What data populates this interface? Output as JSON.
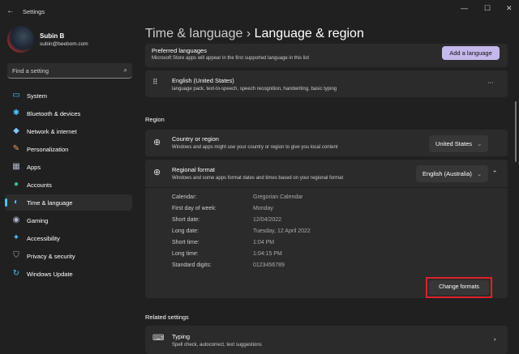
{
  "window": {
    "title": "Settings"
  },
  "user": {
    "name": "Subin B",
    "email": "subin@beebom.com"
  },
  "search": {
    "placeholder": "Find a setting"
  },
  "nav": [
    {
      "label": "System",
      "icon": "monitor-icon"
    },
    {
      "label": "Bluetooth & devices",
      "icon": "bluetooth-icon"
    },
    {
      "label": "Network & internet",
      "icon": "wifi-icon"
    },
    {
      "label": "Personalization",
      "icon": "brush-icon"
    },
    {
      "label": "Apps",
      "icon": "apps-icon"
    },
    {
      "label": "Accounts",
      "icon": "person-icon"
    },
    {
      "label": "Time & language",
      "icon": "globe-clock-icon",
      "selected": true
    },
    {
      "label": "Gaming",
      "icon": "gamepad-icon"
    },
    {
      "label": "Accessibility",
      "icon": "accessibility-icon"
    },
    {
      "label": "Privacy & security",
      "icon": "shield-icon"
    },
    {
      "label": "Windows Update",
      "icon": "update-icon"
    }
  ],
  "header": {
    "parent": "Time & language",
    "sep": "›",
    "current": "Language & region"
  },
  "preferred": {
    "title": "Preferred languages",
    "desc": "Microsoft Store apps will appear in the first supported language in this list",
    "button": "Add a language"
  },
  "language": {
    "name": "English (United States)",
    "desc": "language pack, text-to-speech, speech recognition, handwriting, basic typing",
    "more": "···"
  },
  "region": {
    "section": "Region",
    "country": {
      "title": "Country or region",
      "desc": "Windows and apps might use your country or region to give you local content",
      "value": "United States"
    },
    "format": {
      "title": "Regional format",
      "desc": "Windows and some apps format dates and times based on your regional format",
      "value": "English (Australia)",
      "details": [
        {
          "label": "Calendar:",
          "value": "Gregorian Calendar"
        },
        {
          "label": "First day of week:",
          "value": "Monday"
        },
        {
          "label": "Short date:",
          "value": "12/04/2022"
        },
        {
          "label": "Long date:",
          "value": "Tuesday, 12 April 2022"
        },
        {
          "label": "Short time:",
          "value": "1:04 PM"
        },
        {
          "label": "Long time:",
          "value": "1:04:15 PM"
        },
        {
          "label": "Standard digits:",
          "value": "0123456789"
        }
      ],
      "button": "Change formats"
    }
  },
  "related": {
    "section": "Related settings",
    "typing": {
      "title": "Typing",
      "desc": "Spell check, autocorrect, text suggestions"
    }
  },
  "colors": {
    "accent": "#4cc2ff",
    "highlight": "#e0202a",
    "button": "#c5b8ea"
  }
}
